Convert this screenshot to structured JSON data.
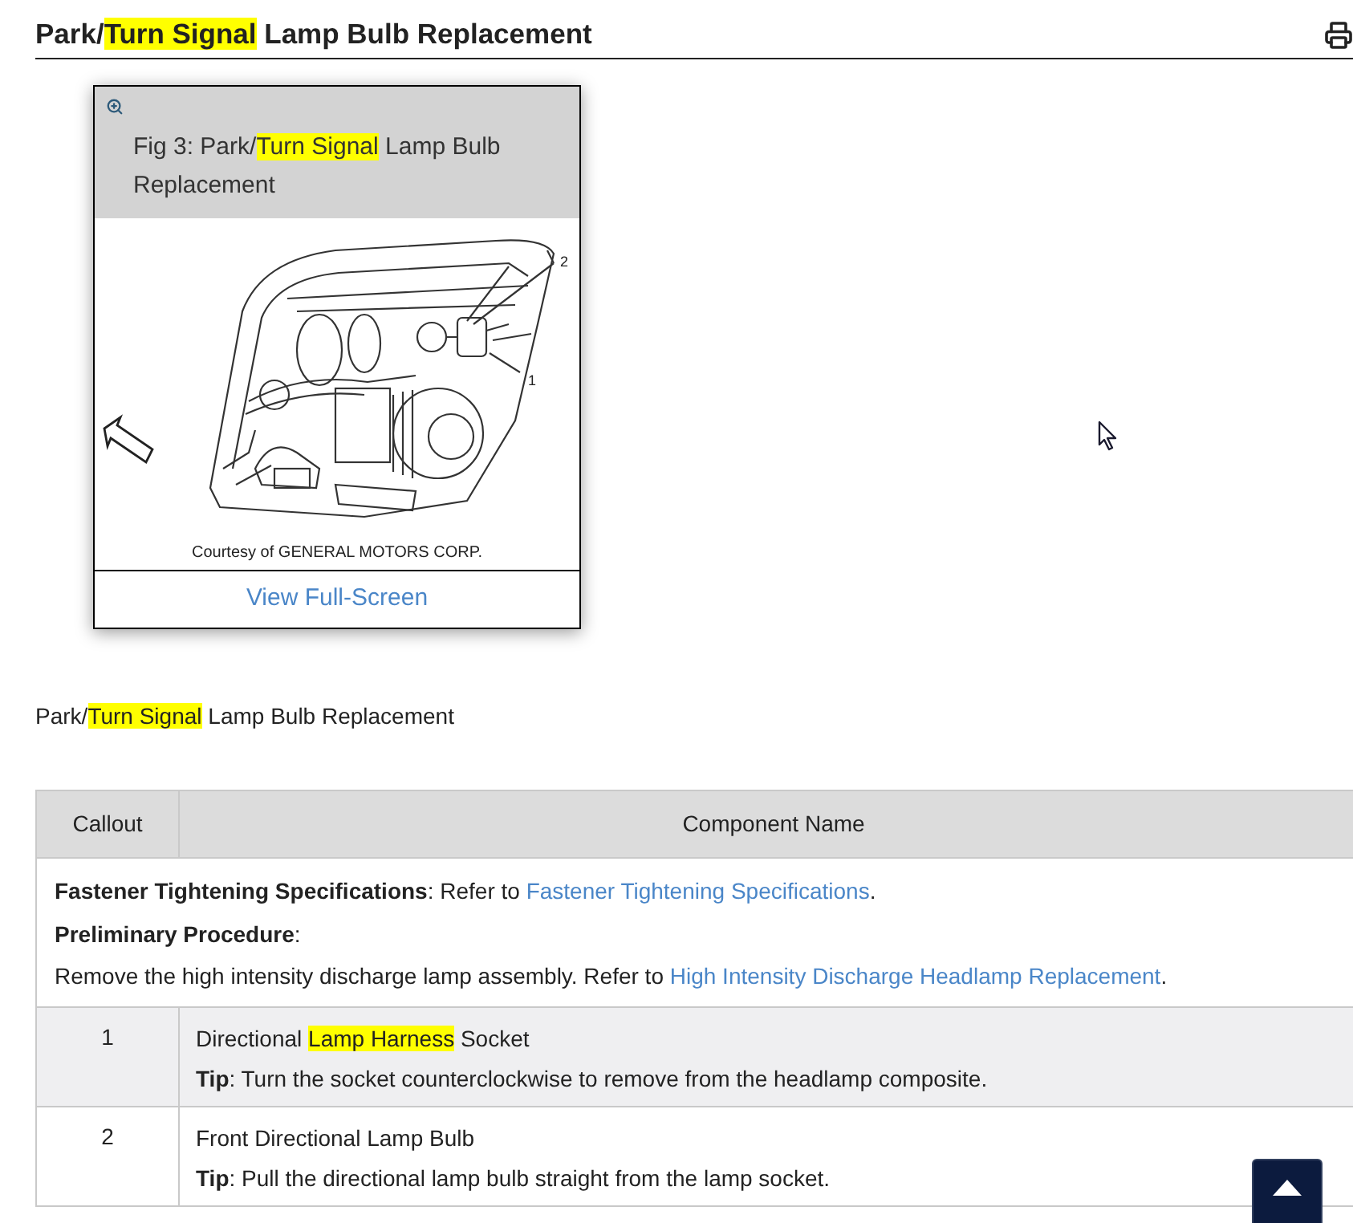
{
  "header": {
    "title": [
      {
        "text": "Park/",
        "highlighted": false
      },
      {
        "text": "Turn Signal",
        "highlighted": true
      },
      {
        "text": " Lamp Bulb Replacement",
        "highlighted": false
      }
    ]
  },
  "figure": {
    "caption": [
      {
        "text": "Fig 3: Park/",
        "highlighted": false
      },
      {
        "text": "Turn Signal",
        "highlighted": true
      },
      {
        "text": " Lamp Bulb Replacement",
        "highlighted": false
      }
    ],
    "callouts": [
      "2",
      "1"
    ],
    "credit": "Courtesy of GENERAL MOTORS CORP.",
    "link": "View Full-Screen"
  },
  "description": [
    {
      "text": "Park/",
      "highlighted": false
    },
    {
      "text": "Turn Signal",
      "highlighted": true
    },
    {
      "text": " Lamp Bulb Replacement",
      "highlighted": false
    }
  ],
  "table": {
    "columns": [
      "Callout",
      "Component Name"
    ],
    "notes": [
      {
        "text": "**Fastener Tightening Specifications**: Refer to ",
        "link": "Fastener Tightening Specifications",
        "end": "."
      },
      {
        "text": "**Preliminary Procedure**:"
      },
      {
        "text": "Remove the high intensity discharge lamp assembly. Refer to ",
        "link": "High Intensity Discharge Headlamp Replacement",
        "end": "."
      }
    ],
    "rows": [
      {
        "callout": "1",
        "name": [
          {
            "text": "Directional ",
            "highlighted": false
          },
          {
            "text": "Lamp Harness",
            "highlighted": true
          },
          {
            "text": " Socket",
            "highlighted": false
          }
        ],
        "tip": "**Tip**: Turn the socket counterclockwise to remove from the headlamp composite."
      },
      {
        "callout": "2",
        "name": [
          {
            "text": "Front Directional Lamp Bulb",
            "highlighted": false
          }
        ],
        "tip": "**Tip**: Pull the directional lamp bulb straight from the lamp socket."
      }
    ]
  }
}
